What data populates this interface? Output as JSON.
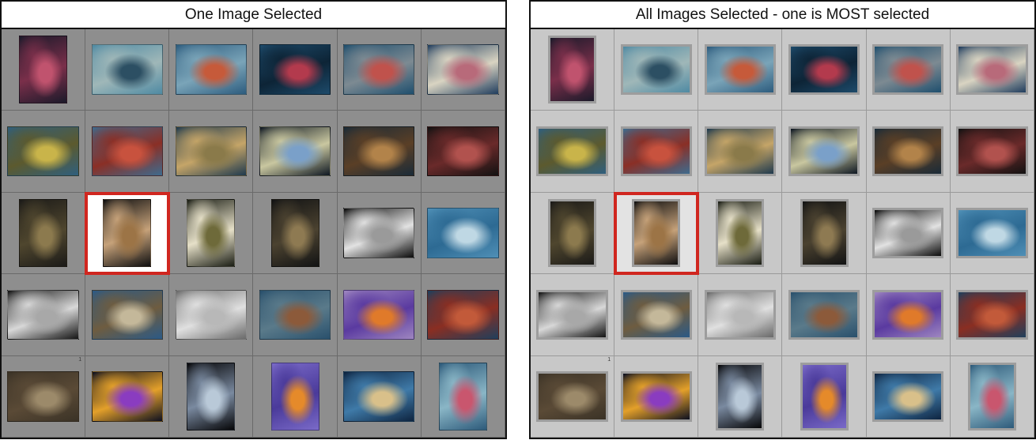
{
  "panels": [
    {
      "title": "One Image Selected",
      "selected_index": 13,
      "cell_number_label": "1"
    },
    {
      "title": "All Images Selected - one is MOST selected",
      "selected_index": 13,
      "cell_number_label": "1"
    }
  ],
  "thumbnails": [
    {
      "orientation": "port",
      "subject": "pink-soft-coral",
      "colors": [
        "#1b1a2a",
        "#c0536e",
        "#7a2f4a"
      ]
    },
    {
      "orientation": "land",
      "subject": "school-of-fish-reef",
      "colors": [
        "#4f8aa3",
        "#2c4f63",
        "#9fb7b8"
      ]
    },
    {
      "orientation": "land",
      "subject": "red-fish-school",
      "colors": [
        "#2d5c7e",
        "#c65a3a",
        "#7aa4b8"
      ]
    },
    {
      "orientation": "land",
      "subject": "red-sea-fan",
      "colors": [
        "#1d4a6a",
        "#b33a4d",
        "#0d2436"
      ]
    },
    {
      "orientation": "land",
      "subject": "reef-with-coral",
      "colors": [
        "#1f4f6e",
        "#c0524c",
        "#7d8a92"
      ]
    },
    {
      "orientation": "land",
      "subject": "coral-garden",
      "colors": [
        "#203d5e",
        "#b86a7a",
        "#d9d4c2"
      ]
    },
    {
      "orientation": "land",
      "subject": "yellow-fish-school",
      "colors": [
        "#2f5f7e",
        "#c9b44a",
        "#5c5a2e"
      ]
    },
    {
      "orientation": "land",
      "subject": "red-coral-reef",
      "colors": [
        "#3e6b8e",
        "#c8523e",
        "#8a2f26"
      ]
    },
    {
      "orientation": "land",
      "subject": "frogfish-on-reef",
      "colors": [
        "#1f3a4e",
        "#8a7a4a",
        "#c5a568"
      ]
    },
    {
      "orientation": "land",
      "subject": "nudibranch",
      "colors": [
        "#0e1722",
        "#7aa0c9",
        "#c9c7a0"
      ]
    },
    {
      "orientation": "land",
      "subject": "scorpionfish",
      "colors": [
        "#1a2b38",
        "#b2834a",
        "#5a3f26"
      ]
    },
    {
      "orientation": "land",
      "subject": "red-frogfish",
      "colors": [
        "#121212",
        "#b1524e",
        "#6a2a2a"
      ]
    },
    {
      "orientation": "port",
      "subject": "crinoid-and-coral",
      "colors": [
        "#1b1a18",
        "#8c7a4e",
        "#4f462e"
      ]
    },
    {
      "orientation": "port",
      "subject": "frogfish-vertical",
      "colors": [
        "#0f0f10",
        "#9c7446",
        "#c6a27a"
      ]
    },
    {
      "orientation": "port",
      "subject": "small-fish-in-hole",
      "colors": [
        "#1a1d14",
        "#6e6a3a",
        "#e6e0c8"
      ]
    },
    {
      "orientation": "port",
      "subject": "crinoid-vertical",
      "colors": [
        "#121314",
        "#8e7a52",
        "#4b4230"
      ]
    },
    {
      "orientation": "land",
      "subject": "shark-black-white",
      "colors": [
        "#0b0b0b",
        "#9a9a9a",
        "#e2e2e2"
      ]
    },
    {
      "orientation": "land",
      "subject": "shark-blue",
      "colors": [
        "#4f8fb6",
        "#bfd8e4",
        "#2d6a93"
      ]
    },
    {
      "orientation": "land",
      "subject": "shark-bw-moon",
      "colors": [
        "#141414",
        "#a8a8a8",
        "#d8d8d8"
      ]
    },
    {
      "orientation": "land",
      "subject": "nurse-shark-reef",
      "colors": [
        "#2b5a86",
        "#c4b89a",
        "#6e5c40"
      ]
    },
    {
      "orientation": "land",
      "subject": "nurse-shark-bw",
      "colors": [
        "#6a6a6a",
        "#b8b8b8",
        "#e0e0e0"
      ]
    },
    {
      "orientation": "land",
      "subject": "grouper-reef",
      "colors": [
        "#29506c",
        "#8c5a3a",
        "#5a7a8a"
      ]
    },
    {
      "orientation": "land",
      "subject": "purple-anthias",
      "colors": [
        "#9e86c0",
        "#e07a2a",
        "#5a3aa0"
      ]
    },
    {
      "orientation": "land",
      "subject": "red-gorgonian",
      "colors": [
        "#1f3f5c",
        "#c25a3a",
        "#8a2e22"
      ]
    },
    {
      "orientation": "land",
      "subject": "grouper-close",
      "colors": [
        "#3a3226",
        "#9c8a6a",
        "#5a4a36"
      ]
    },
    {
      "orientation": "land",
      "subject": "purple-fish-dark",
      "colors": [
        "#0d1020",
        "#8a3cc0",
        "#e3a02a"
      ]
    },
    {
      "orientation": "port",
      "subject": "jawfish",
      "colors": [
        "#060608",
        "#b9c9d8",
        "#7a8aa0"
      ]
    },
    {
      "orientation": "port",
      "subject": "purple-anthias-vertical",
      "colors": [
        "#7a6ac8",
        "#e58a2a",
        "#4a3a9a"
      ]
    },
    {
      "orientation": "land",
      "subject": "brain-coral",
      "colors": [
        "#0e2440",
        "#d9c08a",
        "#3f7aa8"
      ]
    },
    {
      "orientation": "port",
      "subject": "coral-reef-vertical",
      "colors": [
        "#2d5a7a",
        "#c9566e",
        "#8ab6c6"
      ]
    }
  ]
}
